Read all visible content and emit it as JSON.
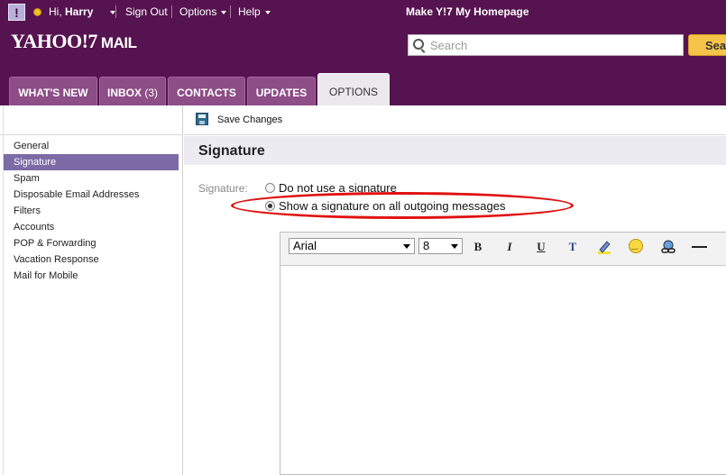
{
  "topbar": {
    "logo_box": "!",
    "greeting_prefix": "Hi,",
    "user_name": "Harry",
    "sign_out": "Sign Out",
    "options": "Options",
    "help": "Help",
    "make_homepage": "Make Y!7 My Homepage"
  },
  "brand": {
    "logo": "YAHOO!7",
    "product": "MAIL"
  },
  "search": {
    "placeholder": "Search",
    "button_label": "Sea"
  },
  "tabs": [
    {
      "label": "WHAT'S NEW"
    },
    {
      "label": "INBOX",
      "count": "(3)"
    },
    {
      "label": "CONTACTS"
    },
    {
      "label": "UPDATES"
    },
    {
      "label": "OPTIONS",
      "active": true
    }
  ],
  "sidebar": {
    "items": [
      {
        "label": "General"
      },
      {
        "label": "Signature",
        "active": true
      },
      {
        "label": "Spam"
      },
      {
        "label": "Disposable Email Addresses"
      },
      {
        "label": "Filters"
      },
      {
        "label": "Accounts"
      },
      {
        "label": "POP & Forwarding"
      },
      {
        "label": "Vacation Response"
      },
      {
        "label": "Mail for Mobile"
      }
    ]
  },
  "toolbar": {
    "save_label": "Save Changes"
  },
  "page": {
    "title": "Signature",
    "signature_label": "Signature:",
    "option_none": "Do not use a signature",
    "option_show": "Show a signature on all outgoing messages",
    "selected_option": "Show a signature on all outgoing messages"
  },
  "editor": {
    "font": "Arial",
    "size": "8",
    "bold": "B",
    "italic": "I",
    "underline": "U",
    "text_color": "T"
  },
  "colors": {
    "header_bg": "#55144f",
    "tab_bg": "#8d4d86",
    "active_sidebar": "#7c6ba6",
    "highlight_ellipse": "#e01010"
  }
}
